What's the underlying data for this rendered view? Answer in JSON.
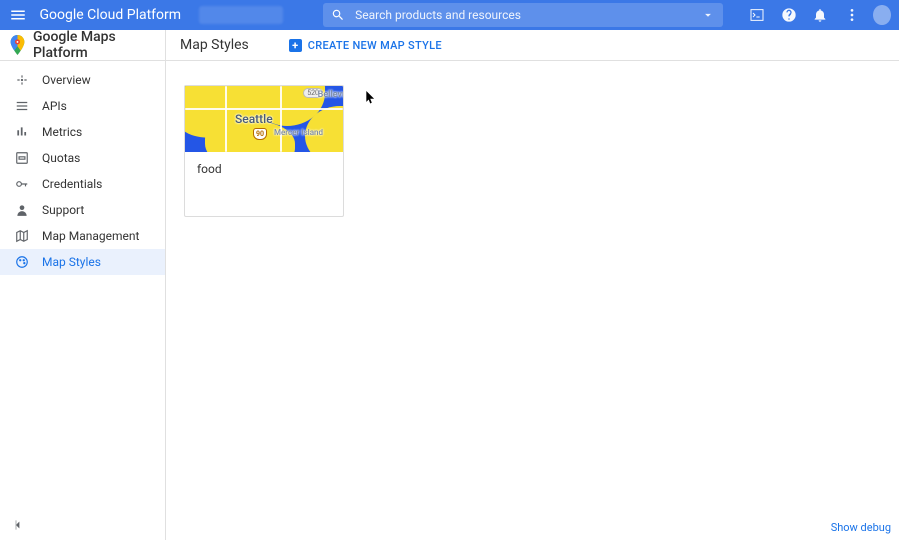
{
  "topbar": {
    "brand": "Google Cloud Platform",
    "search_placeholder": "Search products and resources"
  },
  "product": {
    "name": "Google Maps Platform"
  },
  "page": {
    "title": "Map Styles",
    "create_label": "CREATE NEW MAP STYLE"
  },
  "sidebar": {
    "items": [
      {
        "label": "Overview"
      },
      {
        "label": "APIs"
      },
      {
        "label": "Metrics"
      },
      {
        "label": "Quotas"
      },
      {
        "label": "Credentials"
      },
      {
        "label": "Support"
      },
      {
        "label": "Map Management"
      },
      {
        "label": "Map Styles"
      }
    ]
  },
  "styles_list": {
    "cards": [
      {
        "title": "food",
        "preview": {
          "city_main": "Seattle",
          "city_ne": "Bellevu",
          "city_se": "Mercer Island",
          "highway": "90",
          "zone": "520"
        }
      }
    ]
  },
  "footer": {
    "debug": "Show debug"
  }
}
